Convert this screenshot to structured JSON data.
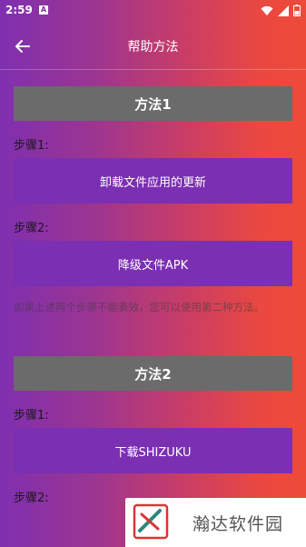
{
  "status_bar": {
    "time": "2:59",
    "badge": "A"
  },
  "app_bar": {
    "title": "帮助方法"
  },
  "method1": {
    "header": "方法1",
    "step1_label": "步骤1:",
    "step1_button": "卸载文件应用的更新",
    "step2_label": "步骤2:",
    "step2_button": "降级文件APK",
    "note": "如果上述两个步骤不能奏效，您可以使用第二种方法。"
  },
  "method2": {
    "header": "方法2",
    "step1_label": "步骤1:",
    "step1_button": "下载SHIZUKU",
    "step2_label": "步骤2:"
  },
  "watermark": {
    "text": "瀚达软件园"
  },
  "colors": {
    "step_button": "#7b2fb2",
    "method_header": "#6b6b6b"
  },
  "icons": {
    "back": "arrow-left-icon",
    "wifi": "wifi-icon",
    "signal": "signal-icon",
    "battery": "battery-icon"
  }
}
